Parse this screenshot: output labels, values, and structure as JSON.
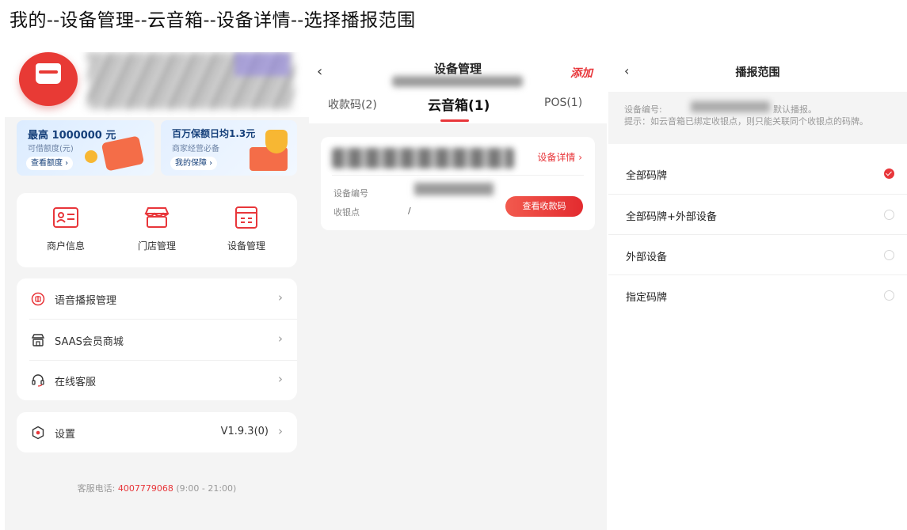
{
  "doc_title": "我的--设备管理--云音箱--设备详情--选择播报范围",
  "panel1": {
    "promos": [
      {
        "title": "最高 1000000 元",
        "sub": "可借额度(元)",
        "button": "查看额度 ›"
      },
      {
        "title": "百万保额日均1.3元",
        "sub": "商家经营必备",
        "button": "我的保障 ›"
      }
    ],
    "grid": [
      {
        "label": "商户信息",
        "icon": "merchant-info-icon"
      },
      {
        "label": "门店管理",
        "icon": "store-icon"
      },
      {
        "label": "设备管理",
        "icon": "device-icon"
      }
    ],
    "menu": [
      {
        "label": "语音播报管理",
        "icon": "voice-broadcast-icon"
      },
      {
        "label": "SAAS会员商城",
        "icon": "mall-icon"
      },
      {
        "label": "在线客服",
        "icon": "headset-icon"
      }
    ],
    "settings": {
      "label": "设置",
      "version": "V1.9.3(0)",
      "icon": "settings-icon"
    },
    "footer": {
      "prefix": "客服电话: ",
      "phone": "4007779068",
      "hours": " (9:00 - 21:00)"
    },
    "chevron": "›",
    "colors": {
      "accent": "#e8363a",
      "background": "#f4f4f4"
    }
  },
  "panel2": {
    "back": "‹",
    "title": "设备管理",
    "add": "添加",
    "tabs": [
      {
        "label": "收款码(2)"
      },
      {
        "label": "云音箱(1)"
      },
      {
        "label": "POS(1)"
      }
    ],
    "device": {
      "detail_link": "设备详情 ›",
      "serial_label": "设备编号",
      "cashier_label": "收银点",
      "cashier_value": "/",
      "button": "查看收款码"
    }
  },
  "panel3": {
    "back": "‹",
    "title": "播报范围",
    "info_prefix": "设备编号:",
    "info_suffix": "默认播报。",
    "info_note": "提示：如云音箱已绑定收银点，则只能关联同个收银点的码牌。",
    "options": [
      {
        "label": "全部码牌",
        "checked": true
      },
      {
        "label": "全部码牌+外部设备",
        "checked": false
      },
      {
        "label": "外部设备",
        "checked": false
      },
      {
        "label": "指定码牌",
        "checked": false
      }
    ]
  }
}
